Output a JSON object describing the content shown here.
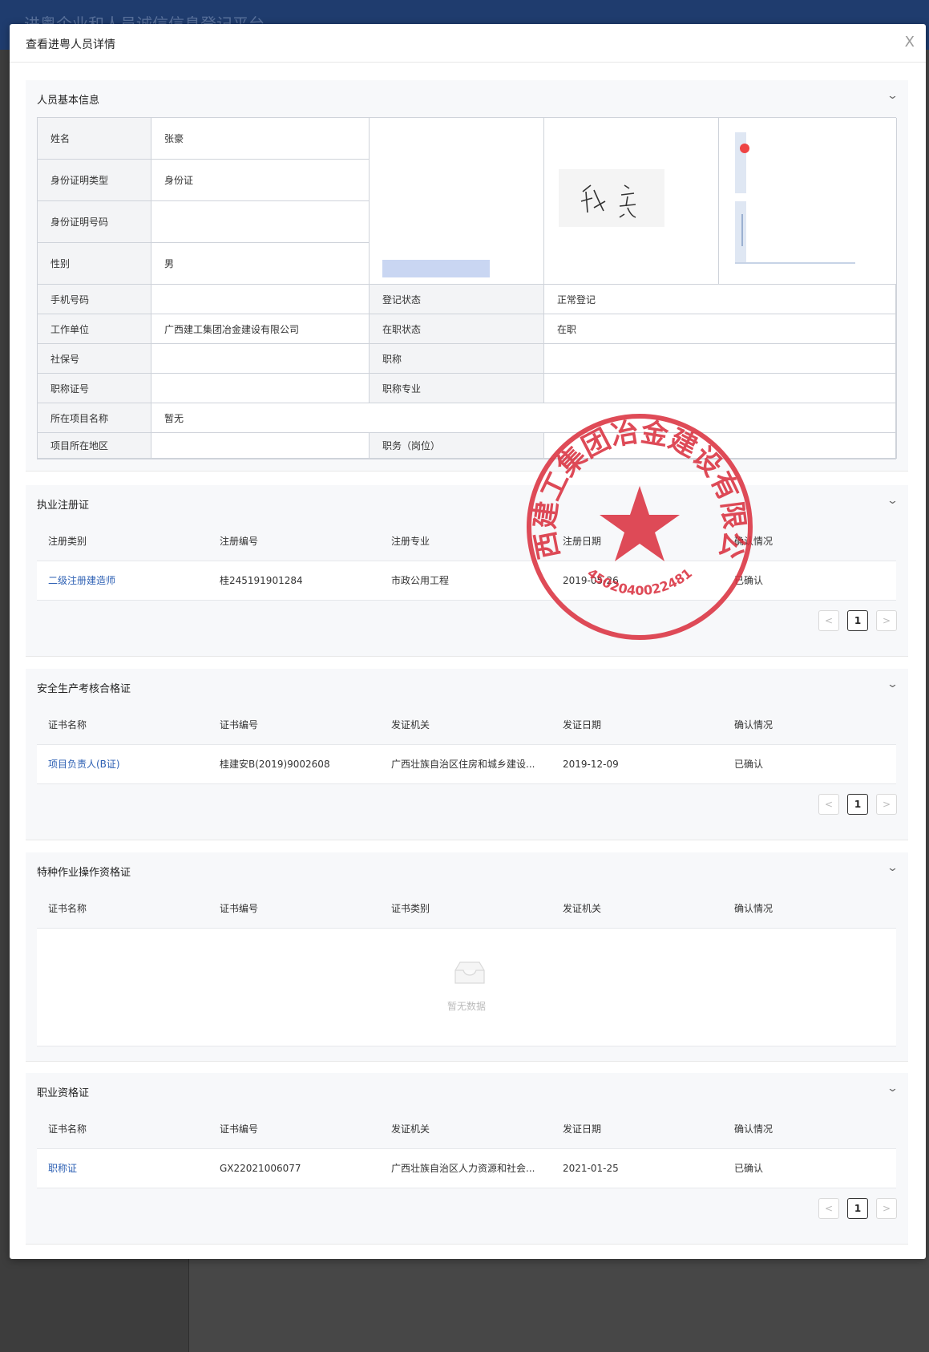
{
  "background": {
    "app_title": "进粤企业和人员诚信信息登记平台"
  },
  "modal": {
    "title": "查看进粤人员详情",
    "close_label": "X"
  },
  "basic_info": {
    "title": "人员基本信息",
    "rows": {
      "name_label": "姓名",
      "name": "张豪",
      "id_type_label": "身份证明类型",
      "id_type": "身份证",
      "id_no_label": "身份证明号码",
      "id_no": "",
      "gender_label": "性别",
      "gender": "男",
      "phone_label": "手机号码",
      "phone": "",
      "reg_status_label": "登记状态",
      "reg_status": "正常登记",
      "employer_label": "工作单位",
      "employer": "广西建工集团冶金建设有限公司",
      "work_status_label": "在职状态",
      "work_status": "在职",
      "social_no_label": "社保号",
      "social_no": "",
      "title_label": "职称",
      "title_value": "",
      "title_cert_label": "职称证号",
      "title_cert": "",
      "title_major_label": "职称专业",
      "title_major": "",
      "project_label": "所在项目名称",
      "project": "暂无",
      "region_label": "项目所在地区",
      "region": "",
      "position_label": "职务（岗位）",
      "position": ""
    }
  },
  "stamp": {
    "text": "广西建工集团冶金建设有限公司",
    "code": "4502040022481",
    "color": "#d92b3a"
  },
  "reg_cert": {
    "title": "执业注册证",
    "headers": [
      "注册类别",
      "注册编号",
      "注册专业",
      "注册日期",
      "确认情况"
    ],
    "rows": [
      [
        "二级注册建造师",
        "桂245191901284",
        "市政公用工程",
        "2019-05-26",
        "已确认"
      ]
    ],
    "page": "1"
  },
  "safety_cert": {
    "title": "安全生产考核合格证",
    "headers": [
      "证书名称",
      "证书编号",
      "发证机关",
      "发证日期",
      "确认情况"
    ],
    "rows": [
      [
        "项目负责人(B证)",
        "桂建安B(2019)9002608",
        "广西壮族自治区住房和城乡建设...",
        "2019-12-09",
        "已确认"
      ]
    ],
    "page": "1"
  },
  "special_cert": {
    "title": "特种作业操作资格证",
    "headers": [
      "证书名称",
      "证书编号",
      "证书类别",
      "发证机关",
      "确认情况"
    ],
    "empty_text": "暂无数据"
  },
  "prof_cert": {
    "title": "职业资格证",
    "headers": [
      "证书名称",
      "证书编号",
      "发证机关",
      "发证日期",
      "确认情况"
    ],
    "rows": [
      [
        "职称证",
        "GX22021006077",
        "广西壮族自治区人力资源和社会...",
        "2021-01-25",
        "已确认"
      ]
    ],
    "page": "1"
  },
  "icons": {
    "collapse": "chevron-down-icon",
    "close": "close-icon",
    "empty": "empty-box-icon"
  }
}
